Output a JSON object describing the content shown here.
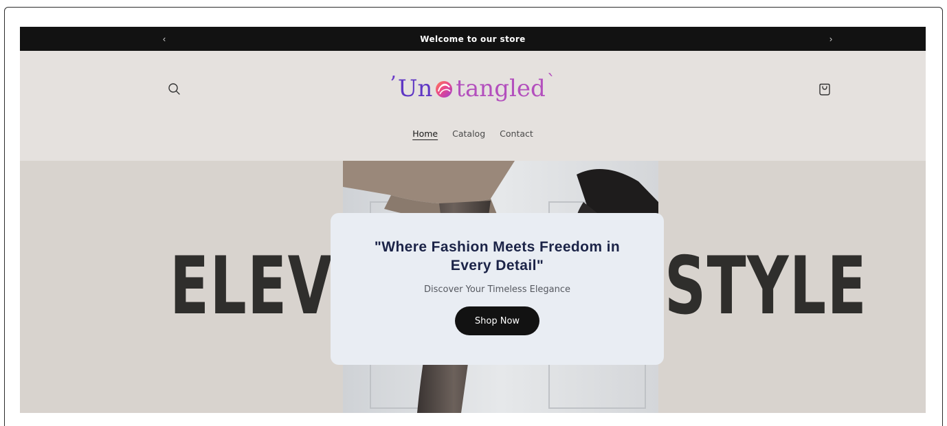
{
  "announcement": {
    "text": "Welcome to our store",
    "prev_arrow": "‹",
    "next_arrow": "›"
  },
  "header": {
    "logo": {
      "mark": "’",
      "part1": "Un",
      "part2": "tangled",
      "tail": "`"
    },
    "icons": {
      "search": "search-icon",
      "cart": "cart-icon"
    },
    "nav": [
      {
        "label": "Home",
        "active": true
      },
      {
        "label": "Catalog",
        "active": false
      },
      {
        "label": "Contact",
        "active": false
      }
    ]
  },
  "hero": {
    "background_word_left": "ELEV",
    "background_word_right": "STYLE",
    "promo": {
      "title": "\"Where Fashion Meets Freedom in Every Detail\"",
      "subtitle": "Discover Your Timeless Elegance",
      "button": "Shop Now"
    }
  },
  "colors": {
    "announcement_bg": "#121212",
    "header_bg": "#e5e1de",
    "hero_bg": "#d8d3ce",
    "promo_bg": "#e9edf3",
    "promo_title": "#1b2347",
    "logo_purple": "#5e36c4",
    "logo_pink": "#b34fbd",
    "button_bg": "#121212"
  }
}
